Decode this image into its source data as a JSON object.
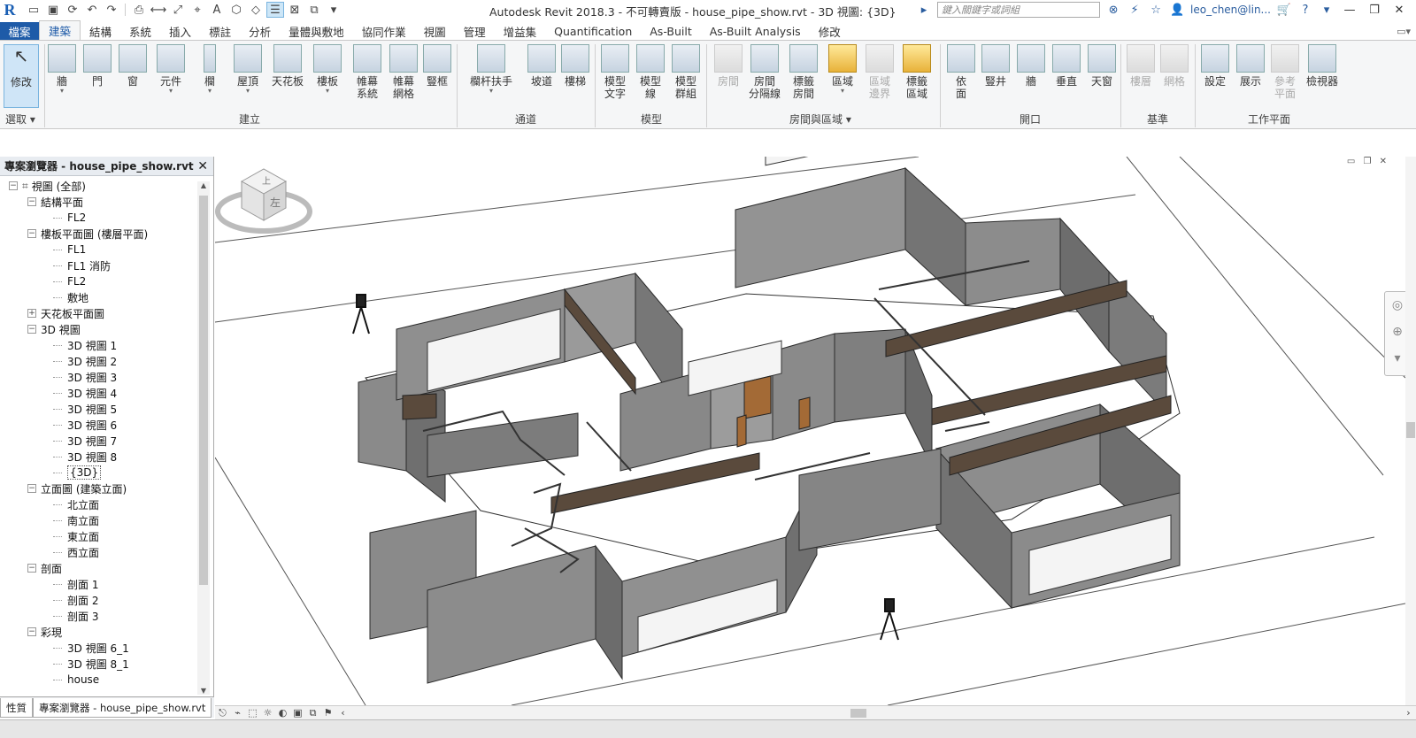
{
  "titlebar": {
    "app_title": "Autodesk Revit 2018.3 - 不可轉賣版 -     house_pipe_show.rvt - 3D 視圖: {3D}",
    "search_placeholder": "鍵入關鍵字或詞組",
    "user": "leo_chen@lin...",
    "help": "?"
  },
  "menu": {
    "file": "檔案",
    "tabs": [
      "建築",
      "結構",
      "系統",
      "插入",
      "標註",
      "分析",
      "量體與敷地",
      "協同作業",
      "視圖",
      "管理",
      "增益集",
      "Quantification",
      "As-Built",
      "As-Built Analysis",
      "修改"
    ],
    "active_index": 0
  },
  "ribbon": {
    "select": {
      "label": "修改",
      "panel": "選取"
    },
    "build": {
      "panel": "建立",
      "tools": [
        "牆",
        "門",
        "窗",
        "元件",
        "欄",
        "屋頂",
        "天花板",
        "樓板",
        "帷幕\n系統",
        "帷幕\n網格",
        "豎框"
      ]
    },
    "circulation": {
      "panel": "通道",
      "tools": [
        "欄杆扶手",
        "坡道",
        "樓梯"
      ]
    },
    "model": {
      "panel": "模型",
      "tools": [
        "模型\n文字",
        "模型\n線",
        "模型\n群組"
      ]
    },
    "room": {
      "panel": "房間與區域",
      "tools": [
        "房間",
        "房間\n分隔線",
        "標籤\n房間",
        "區域",
        "區域\n邊界",
        "標籤\n區域"
      ]
    },
    "opening": {
      "panel": "開口",
      "tools": [
        "依\n面",
        "豎井",
        "牆",
        "垂直",
        "天窗"
      ]
    },
    "datum": {
      "panel": "基準",
      "tools": [
        "樓層",
        "網格"
      ]
    },
    "workplane": {
      "panel": "工作平面",
      "tools": [
        "設定",
        "展示",
        "參考\n平面",
        "檢視器"
      ]
    }
  },
  "project_browser": {
    "title": "專案瀏覽器 - house_pipe_show.rvt",
    "tree": [
      {
        "level": 0,
        "toggle": "−",
        "label": "視圖 (全部)",
        "icon": "views-icon"
      },
      {
        "level": 1,
        "toggle": "−",
        "label": "結構平面"
      },
      {
        "level": 2,
        "label": "FL2"
      },
      {
        "level": 1,
        "toggle": "−",
        "label": "樓板平面圖 (樓層平面)"
      },
      {
        "level": 2,
        "label": "FL1"
      },
      {
        "level": 2,
        "label": "FL1 消防"
      },
      {
        "level": 2,
        "label": "FL2"
      },
      {
        "level": 2,
        "label": "敷地"
      },
      {
        "level": 1,
        "toggle": "+",
        "label": "天花板平面圖"
      },
      {
        "level": 1,
        "toggle": "−",
        "label": "3D 視圖"
      },
      {
        "level": 2,
        "label": "3D 視圖 1"
      },
      {
        "level": 2,
        "label": "3D 視圖 2"
      },
      {
        "level": 2,
        "label": "3D 視圖 3"
      },
      {
        "level": 2,
        "label": "3D 視圖 4"
      },
      {
        "level": 2,
        "label": "3D 視圖 5"
      },
      {
        "level": 2,
        "label": "3D 視圖 6"
      },
      {
        "level": 2,
        "label": "3D 視圖 7"
      },
      {
        "level": 2,
        "label": "3D 視圖 8"
      },
      {
        "level": 2,
        "label": "{3D}",
        "highlight": true
      },
      {
        "level": 1,
        "toggle": "−",
        "label": "立面圖 (建築立面)"
      },
      {
        "level": 2,
        "label": "北立面"
      },
      {
        "level": 2,
        "label": "南立面"
      },
      {
        "level": 2,
        "label": "東立面"
      },
      {
        "level": 2,
        "label": "西立面"
      },
      {
        "level": 1,
        "toggle": "−",
        "label": "剖面"
      },
      {
        "level": 2,
        "label": "剖面 1"
      },
      {
        "level": 2,
        "label": "剖面 2"
      },
      {
        "level": 2,
        "label": "剖面 3"
      },
      {
        "level": 1,
        "toggle": "−",
        "label": "彩現"
      },
      {
        "level": 2,
        "label": "3D 視圖 6_1"
      },
      {
        "level": 2,
        "label": "3D 視圖 8_1"
      },
      {
        "level": 2,
        "label": "house"
      }
    ],
    "tabs": [
      "性質",
      "專案瀏覽器 - house_pipe_show.rvt"
    ]
  },
  "viewcube": {
    "face_top": "上",
    "face_front": "左"
  },
  "colors": {
    "accent": "#1e5ba8",
    "wall": "#8a8a8a",
    "wall_dark": "#6a6a6a",
    "beam": "#5a4a3c"
  }
}
